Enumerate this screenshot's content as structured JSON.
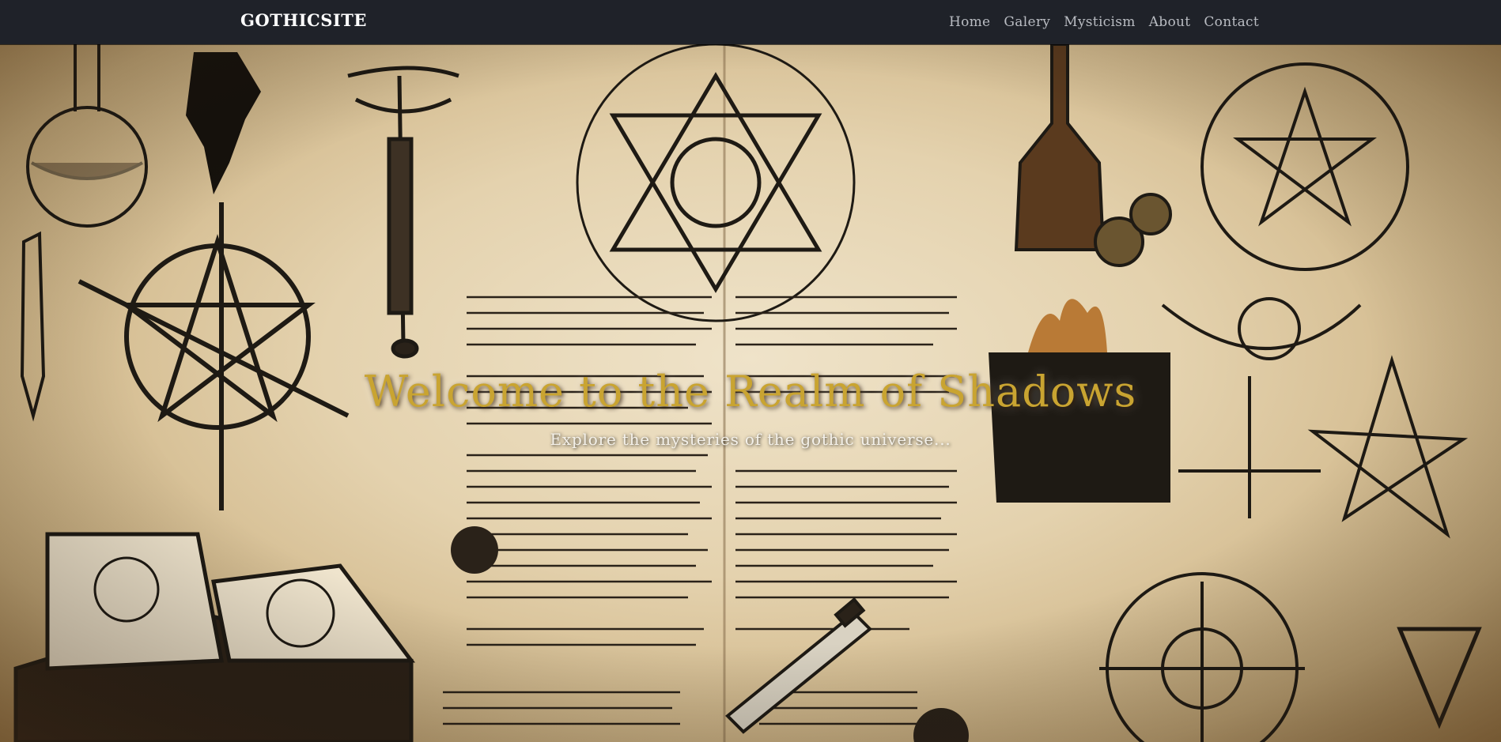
{
  "navbar": {
    "brand": "GOTHICSITE",
    "items": [
      {
        "label": "Home"
      },
      {
        "label": "Galery"
      },
      {
        "label": "Mysticism"
      },
      {
        "label": "About"
      },
      {
        "label": "Contact"
      }
    ]
  },
  "hero": {
    "title": "Welcome to the Realm of Shadows",
    "subtitle": "Explore the mysteries of the gothic universe...",
    "background_image": "gothic-manuscript-illustration"
  },
  "colors": {
    "navbar_bg": "#1f2229",
    "title_gold": "#c9a431",
    "parchment": "#e4d2ae"
  }
}
